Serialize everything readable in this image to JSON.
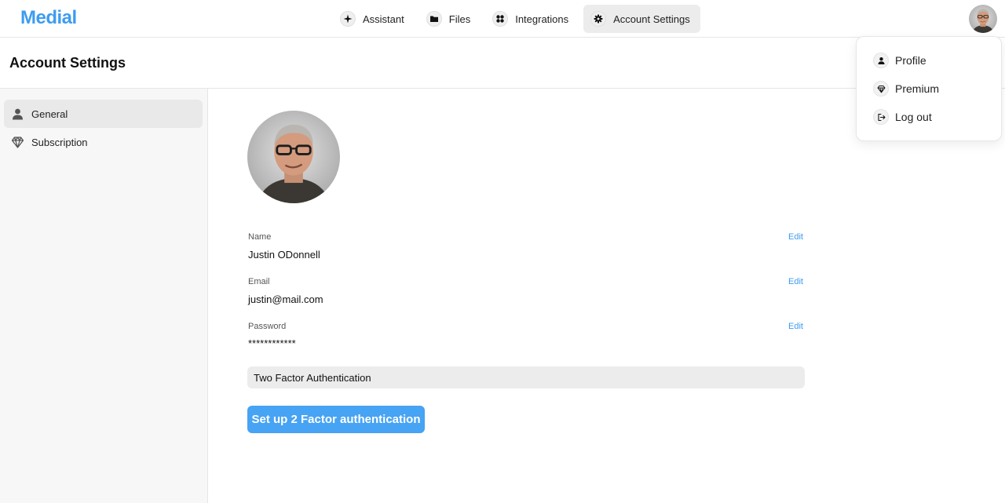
{
  "app": {
    "logo": "Medial"
  },
  "nav": {
    "items": [
      {
        "label": "Assistant",
        "icon": "sparkle-icon"
      },
      {
        "label": "Files",
        "icon": "folder-icon"
      },
      {
        "label": "Integrations",
        "icon": "grid-icon"
      },
      {
        "label": "Account Settings",
        "icon": "gear-icon",
        "active": true
      }
    ]
  },
  "page": {
    "title": "Account Settings"
  },
  "sidebar": {
    "items": [
      {
        "label": "General",
        "icon": "user-icon",
        "active": true
      },
      {
        "label": "Subscription",
        "icon": "diamond-icon"
      }
    ]
  },
  "profile": {
    "fields": [
      {
        "label": "Name",
        "value": "Justin ODonnell",
        "edit": "Edit"
      },
      {
        "label": "Email",
        "value": "justin@mail.com",
        "edit": "Edit"
      },
      {
        "label": "Password",
        "value": "************",
        "edit": "Edit"
      }
    ],
    "two_factor": {
      "heading": "Two Factor Authentication",
      "button": "Set up 2 Factor authentication"
    }
  },
  "user_menu": {
    "items": [
      {
        "label": "Profile",
        "icon": "user-icon"
      },
      {
        "label": "Premium",
        "icon": "diamond-icon"
      },
      {
        "label": "Log out",
        "icon": "logout-icon"
      }
    ]
  },
  "colors": {
    "accent": "#3d9cf0",
    "button": "#47a3f3"
  }
}
